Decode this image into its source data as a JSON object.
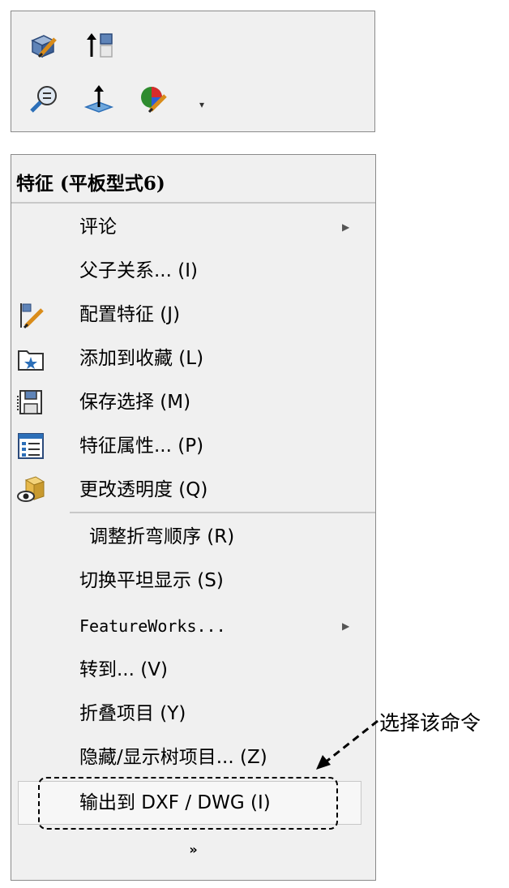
{
  "toolbar": {
    "icons": [
      "edit-part-icon",
      "move-to-top-icon",
      "zoom-to-selection-icon",
      "normal-to-icon",
      "appearance-icon"
    ],
    "dropdown_arrow": "▾"
  },
  "menu": {
    "title": "特征  (平板型式6)",
    "items": [
      {
        "label": "评论",
        "icon": "",
        "submenu": true
      },
      {
        "label": "父子关系...  (I)",
        "icon": ""
      },
      {
        "label": "配置特征  (J)",
        "icon": "configure-feature-icon"
      },
      {
        "label": "添加到收藏  (L)",
        "icon": "add-to-favorites-icon"
      },
      {
        "label": "保存选择  (M)",
        "icon": "save-selection-icon"
      },
      {
        "label": "特征属性...  (P)",
        "icon": "feature-properties-icon"
      },
      {
        "label": "更改透明度  (Q)",
        "icon": "change-transparency-icon"
      },
      {
        "label": "调整折弯顺序  (R)",
        "icon": ""
      },
      {
        "label": "切换平坦显示  (S)",
        "icon": ""
      },
      {
        "label": "FeatureWorks...",
        "icon": "",
        "submenu": true
      },
      {
        "label": "转到...  (V)",
        "icon": ""
      },
      {
        "label": "折叠项目  (Y)",
        "icon": ""
      },
      {
        "label": "隐藏/显示树项目...  (Z)",
        "icon": ""
      },
      {
        "label": "输出到 DXF / DWG  (I)",
        "icon": "",
        "selected": true
      }
    ],
    "submenu_arrow": "▶",
    "more_label": "»"
  },
  "callout": {
    "text": "选择该命令"
  }
}
